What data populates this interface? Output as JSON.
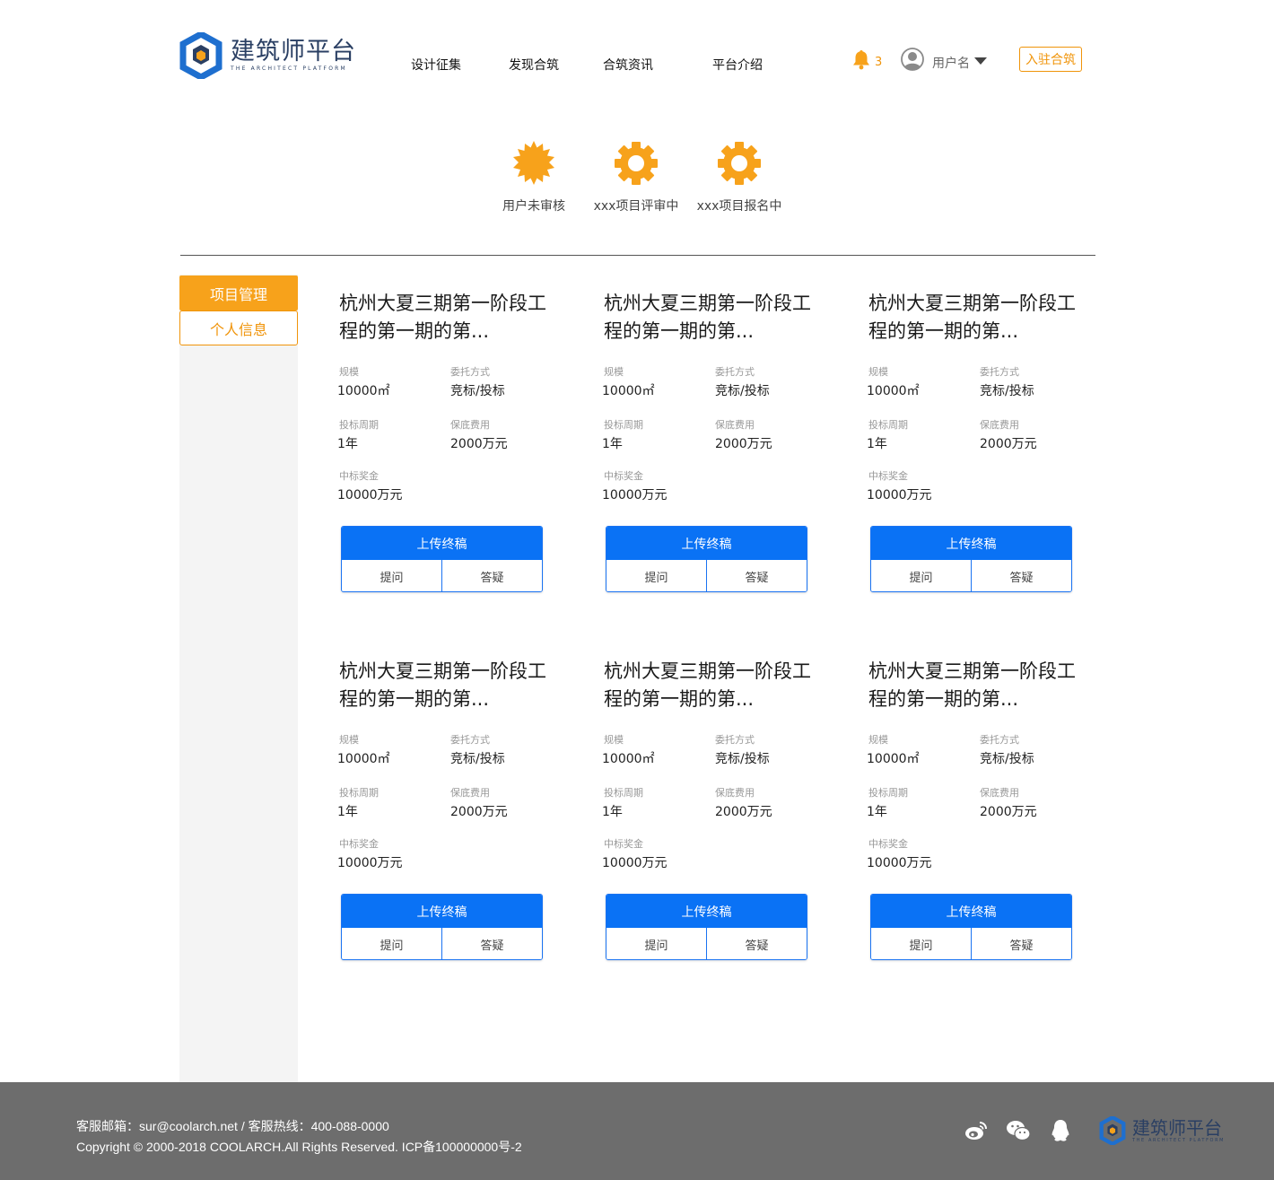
{
  "brand": {
    "name_cn": "建筑师平台",
    "name_en": "THE ARCHITECT PLATFORM"
  },
  "nav": {
    "items": [
      "设计征集",
      "发现合筑",
      "合筑资讯",
      "平台介绍"
    ]
  },
  "header": {
    "bell_icon": "bell-icon",
    "notification_count": "3",
    "username": "用户名",
    "join_label": "入驻合筑"
  },
  "statuses": [
    {
      "label": "用户未审核",
      "icon": "sun-badge-icon"
    },
    {
      "label": "xxx项目评审中",
      "icon": "gear-icon"
    },
    {
      "label": "xxx项目报名中",
      "icon": "gear-icon"
    }
  ],
  "sidebar": {
    "items": [
      {
        "label": "项目管理",
        "active": true
      },
      {
        "label": "个人信息",
        "active": false
      }
    ]
  },
  "labels": {
    "scale": "规模",
    "method": "委托方式",
    "period": "投标周期",
    "fee": "保底费用",
    "prize": "中标奖金"
  },
  "cards": [
    {
      "title": "杭州大夏三期第一阶段工程的第一期的第...",
      "scale": "10000㎡",
      "method": "竞标/投标",
      "period": "1年",
      "fee": "2000万元",
      "prize": "10000万元",
      "upload": "上传终稿",
      "ask": "提问",
      "answer": "答疑"
    },
    {
      "title": "杭州大夏三期第一阶段工程的第一期的第...",
      "scale": "10000㎡",
      "method": "竞标/投标",
      "period": "1年",
      "fee": "2000万元",
      "prize": "10000万元",
      "upload": "上传终稿",
      "ask": "提问",
      "answer": "答疑"
    },
    {
      "title": "杭州大夏三期第一阶段工程的第一期的第...",
      "scale": "10000㎡",
      "method": "竞标/投标",
      "period": "1年",
      "fee": "2000万元",
      "prize": "10000万元",
      "upload": "上传终稿",
      "ask": "提问",
      "answer": "答疑"
    },
    {
      "title": "杭州大夏三期第一阶段工程的第一期的第...",
      "scale": "10000㎡",
      "method": "竞标/投标",
      "period": "1年",
      "fee": "2000万元",
      "prize": "10000万元",
      "upload": "上传终稿",
      "ask": "提问",
      "answer": "答疑"
    },
    {
      "title": "杭州大夏三期第一阶段工程的第一期的第...",
      "scale": "10000㎡",
      "method": "竞标/投标",
      "period": "1年",
      "fee": "2000万元",
      "prize": "10000万元",
      "upload": "上传终稿",
      "ask": "提问",
      "answer": "答疑"
    },
    {
      "title": "杭州大夏三期第一阶段工程的第一期的第...",
      "scale": "10000㎡",
      "method": "竞标/投标",
      "period": "1年",
      "fee": "2000万元",
      "prize": "10000万元",
      "upload": "上传终稿",
      "ask": "提问",
      "answer": "答疑"
    }
  ],
  "footer": {
    "contact": "客服邮箱：sur@coolarch.net / 客服热线：400-088-0000",
    "copyright": "Copyright © 2000-2018 COOLARCH.All Rights Reserved.  ICP备100000000号-2",
    "social_icons": [
      "weibo-icon",
      "wechat-icon",
      "qq-icon"
    ]
  },
  "colors": {
    "accent_orange": "#f7a21b",
    "primary_blue": "#0a72f5",
    "brand_navy": "#2a3f63",
    "footer_gray": "#6d6d6d"
  }
}
